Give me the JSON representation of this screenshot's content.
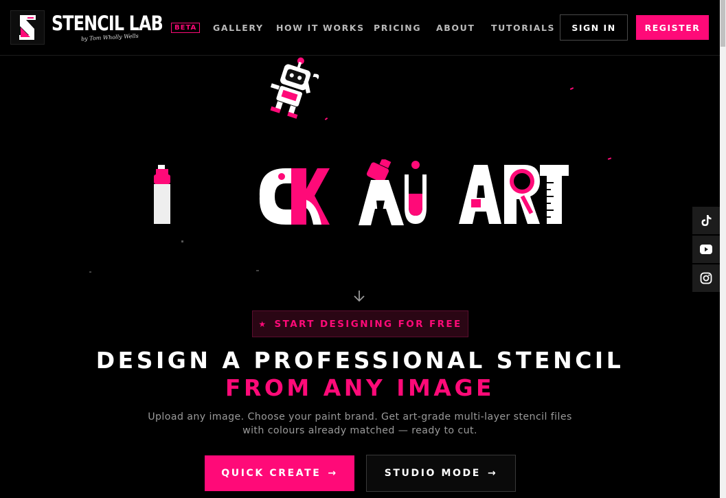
{
  "brand": {
    "name": "STENCIL LAB",
    "byline": "by Tom Wholly Wells",
    "beta_label": "BETA",
    "accent_color": "#ff0a78"
  },
  "nav": {
    "links": [
      {
        "label": "GALLERY"
      },
      {
        "label": "HOW IT WORKS"
      },
      {
        "label": "PRICING"
      },
      {
        "label": "ABOUT"
      },
      {
        "label": "TUTORIALS"
      }
    ],
    "sign_in_label": "SIGN IN",
    "register_label": "REGISTER"
  },
  "hero_art": {
    "icons": [
      "robot-icon",
      "spray-can-icon",
      "test-tube-icon",
      "magnifier-icon",
      "ruler-icon"
    ],
    "art_letters": [
      "C",
      "K",
      "A",
      "U",
      "A",
      "R",
      "T"
    ]
  },
  "social": [
    {
      "icon": "tiktok-icon"
    },
    {
      "icon": "youtube-icon"
    },
    {
      "icon": "instagram-icon"
    }
  ],
  "hero": {
    "badge_label": "START DESIGNING FOR FREE",
    "headline_line1": "DESIGN A PROFESSIONAL STENCIL",
    "headline_line2": "FROM ANY IMAGE",
    "subtext_line1": "Upload any image. Choose your paint brand. Get art-grade multi-layer stencil files",
    "subtext_line2": "with colours already matched — ready to cut.",
    "quick_create_label": "QUICK CREATE",
    "studio_mode_label": "STUDIO MODE",
    "arrow_glyph": "→"
  }
}
